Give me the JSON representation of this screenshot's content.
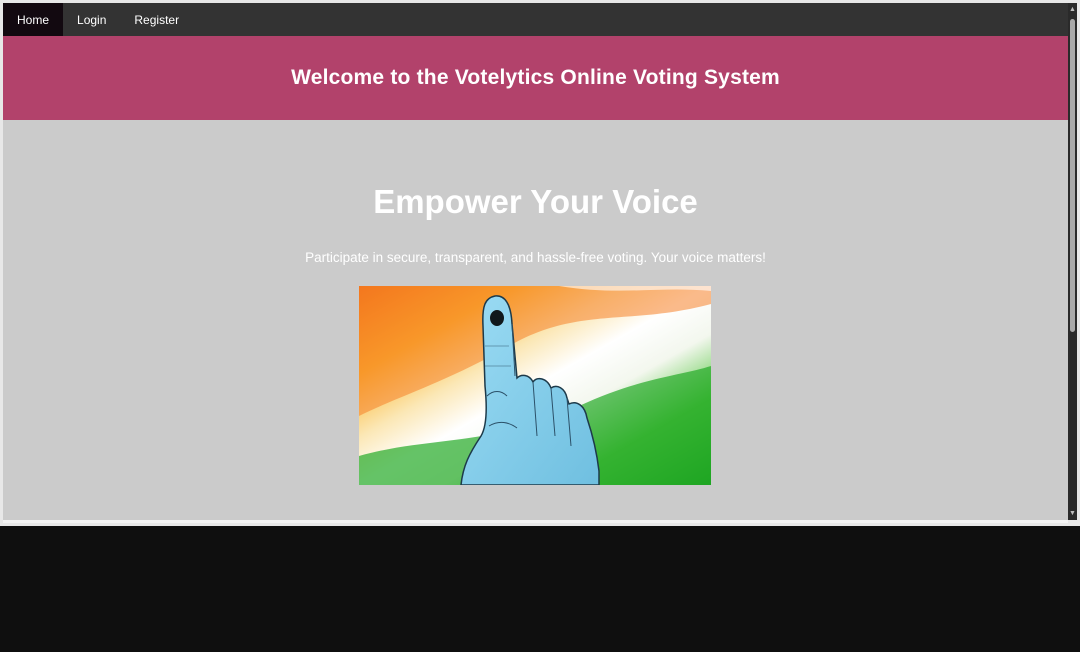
{
  "nav": {
    "items": [
      {
        "label": "Home",
        "active": true
      },
      {
        "label": "Login",
        "active": false
      },
      {
        "label": "Register",
        "active": false
      }
    ]
  },
  "header": {
    "title": "Welcome to the Votelytics Online Voting System"
  },
  "main": {
    "heading": "Empower Your Voice",
    "tagline": "Participate in secure, transparent, and hassle-free voting. Your voice matters!",
    "hero_image": "inked-finger-voting-hand-over-tricolor-flag"
  },
  "colors": {
    "nav_bg": "#333333",
    "nav_active_bg": "#120910",
    "header_bg": "#b2426b",
    "page_bg": "#cbcbcb",
    "flag_saffron": "#f7841e",
    "flag_white": "#ffffff",
    "flag_green": "#1ea71e",
    "hand_blue": "#8fd3ee"
  }
}
